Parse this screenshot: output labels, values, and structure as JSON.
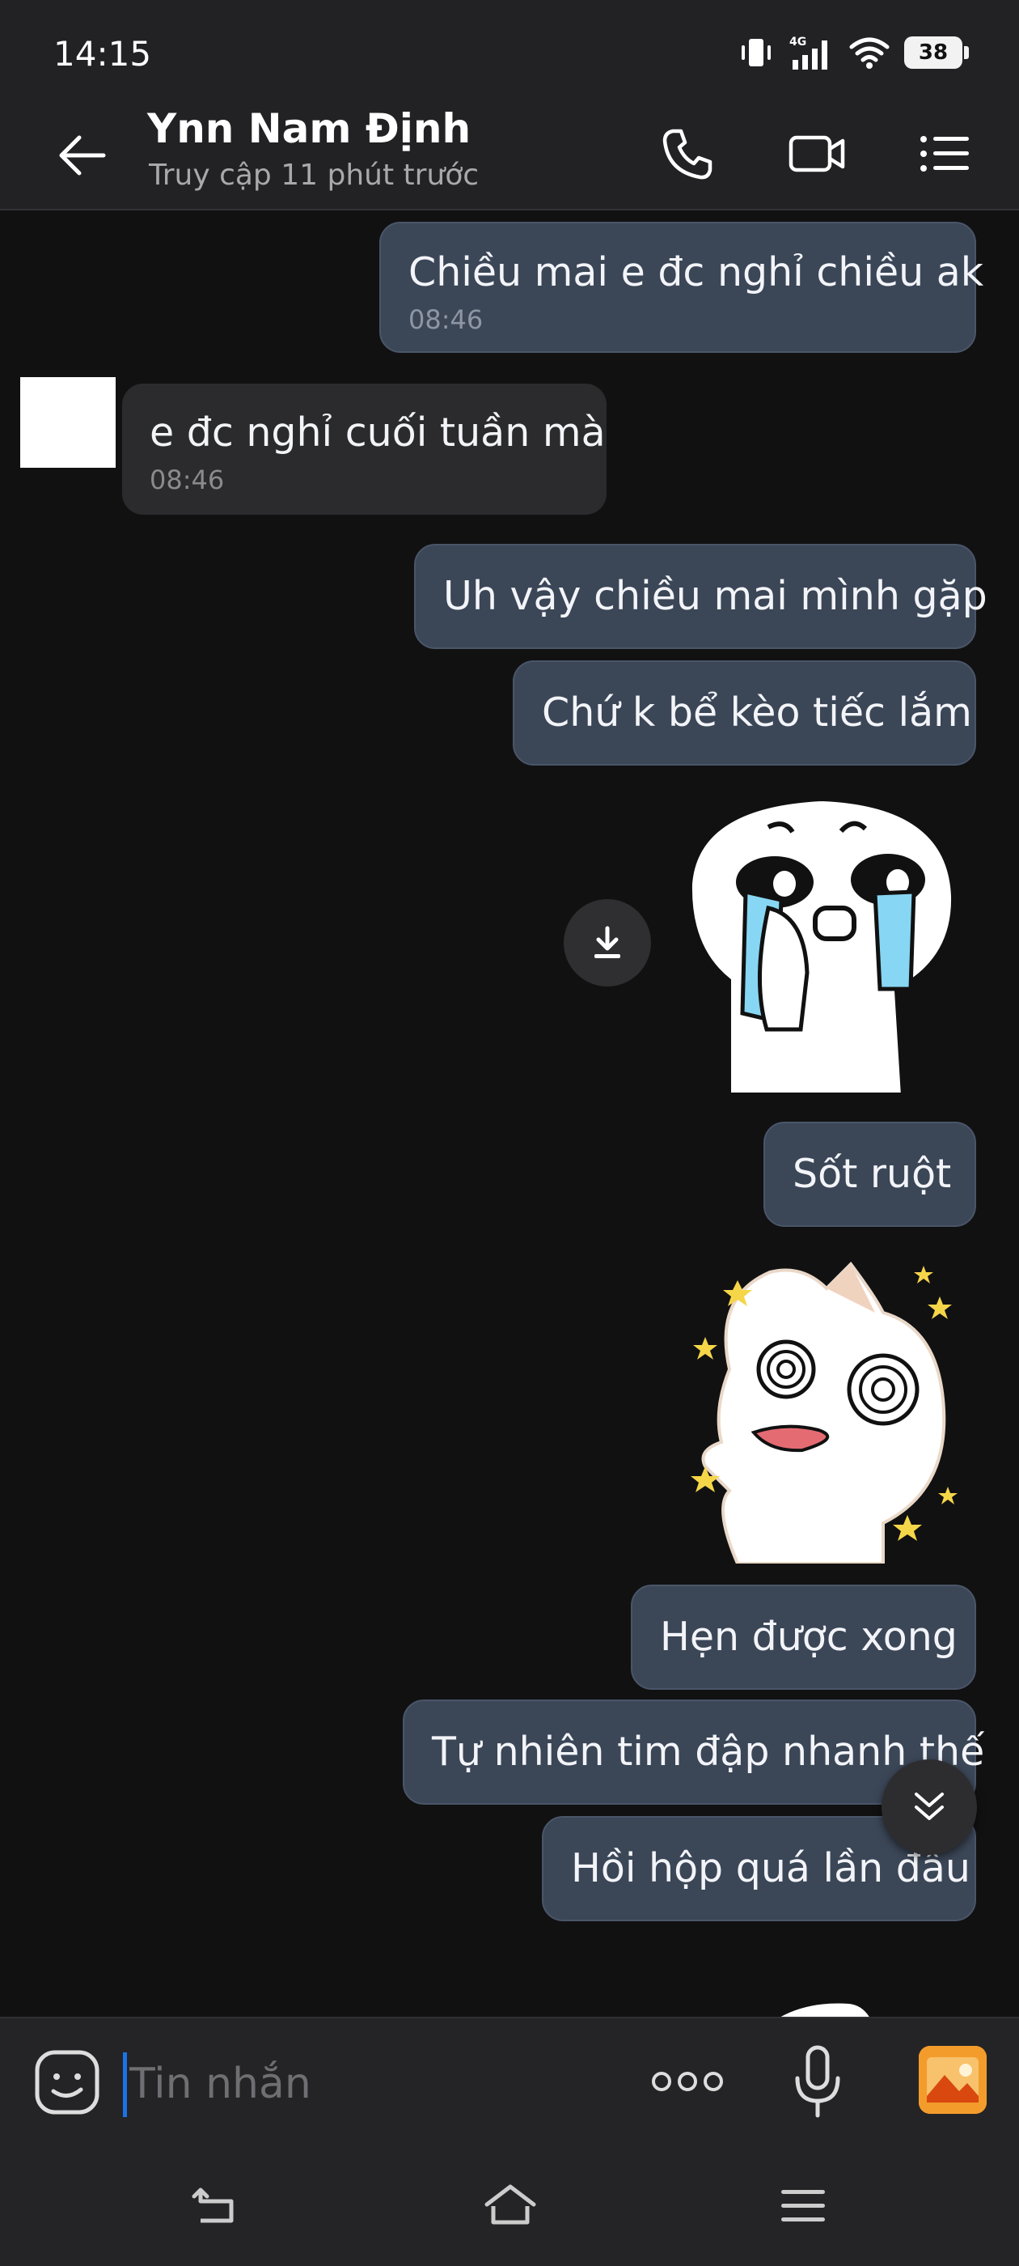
{
  "status_bar": {
    "time": "14:15",
    "network": "4G",
    "battery": "38"
  },
  "header": {
    "contact_name": "Ynn Nam Định",
    "last_seen": "Truy cập 11 phút trước"
  },
  "messages": [
    {
      "direction": "out",
      "text": "Chiều mai e đc nghỉ chiều ak",
      "time": "08:46"
    },
    {
      "direction": "in",
      "text": "e đc nghỉ cuối tuần mà",
      "time": "08:46"
    },
    {
      "direction": "out",
      "text": "Uh vậy chiều mai mình gặp"
    },
    {
      "direction": "out",
      "text": "Chứ k bể kèo tiếc lắm"
    },
    {
      "direction": "out",
      "type": "sticker",
      "name": "crying-sticker"
    },
    {
      "direction": "out",
      "text": "Sốt ruột"
    },
    {
      "direction": "out",
      "type": "sticker",
      "name": "dizzy-sticker"
    },
    {
      "direction": "out",
      "text": "Hẹn được xong"
    },
    {
      "direction": "out",
      "text": "Tự nhiên tim đập nhanh thế"
    },
    {
      "direction": "out",
      "text": "Hồi hộp quá lần đầu"
    }
  ],
  "input": {
    "placeholder": "Tin nhắn"
  },
  "colors": {
    "background": "#111112",
    "bar": "#222224",
    "outgoing_bubble": "#3b4657",
    "incoming_bubble": "#2b2b2d",
    "cursor": "#1a73e8",
    "gallery_accent": "#f39c2c"
  },
  "icons": [
    "back-arrow-icon",
    "phone-icon",
    "video-call-icon",
    "list-menu-icon",
    "download-icon",
    "double-chevron-down-icon",
    "sticker-emoji-icon",
    "more-dots-icon",
    "microphone-icon",
    "gallery-icon",
    "nav-back-icon",
    "nav-home-icon",
    "nav-menu-icon"
  ]
}
